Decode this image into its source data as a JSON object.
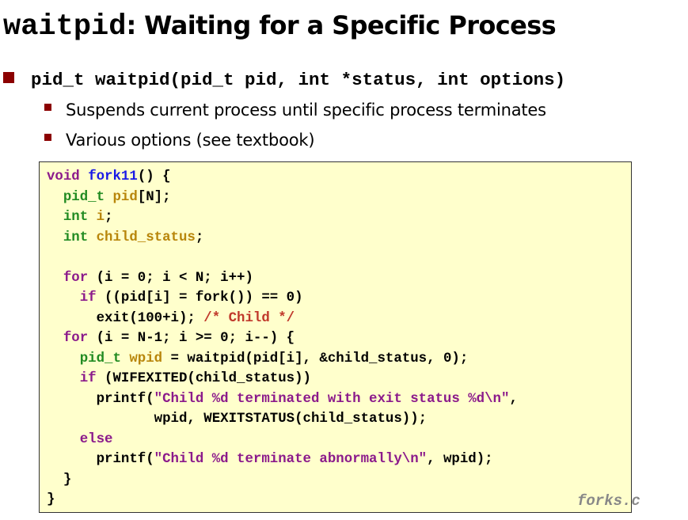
{
  "title": {
    "mono": "waitpid",
    "rest": ": Waiting for a Specific Process"
  },
  "bullet_main": "pid_t waitpid(pid_t pid, int *status, int options)",
  "sub_bullets": [
    "Suspends current process until specific process terminates",
    "Various options (see textbook)"
  ],
  "code": {
    "lines": [
      [
        {
          "t": "void ",
          "c": "kw"
        },
        {
          "t": "fork11",
          "c": "fn"
        },
        {
          "t": "() {",
          "c": ""
        }
      ],
      [
        {
          "t": "  ",
          "c": ""
        },
        {
          "t": "pid_t ",
          "c": "ty"
        },
        {
          "t": "pid",
          "c": "id"
        },
        {
          "t": "[N];",
          "c": ""
        }
      ],
      [
        {
          "t": "  ",
          "c": ""
        },
        {
          "t": "int ",
          "c": "ty"
        },
        {
          "t": "i",
          "c": "id"
        },
        {
          "t": ";",
          "c": ""
        }
      ],
      [
        {
          "t": "  ",
          "c": ""
        },
        {
          "t": "int ",
          "c": "ty"
        },
        {
          "t": "child_status",
          "c": "id"
        },
        {
          "t": ";",
          "c": ""
        }
      ],
      [
        {
          "t": "",
          "c": ""
        }
      ],
      [
        {
          "t": "  ",
          "c": ""
        },
        {
          "t": "for",
          "c": "kw"
        },
        {
          "t": " (i = 0; i < N; i++)",
          "c": ""
        }
      ],
      [
        {
          "t": "    ",
          "c": ""
        },
        {
          "t": "if",
          "c": "kw"
        },
        {
          "t": " ((pid[i] = fork()) == 0)",
          "c": ""
        }
      ],
      [
        {
          "t": "      exit(100+i); ",
          "c": ""
        },
        {
          "t": "/* Child */",
          "c": "cm"
        }
      ],
      [
        {
          "t": "  ",
          "c": ""
        },
        {
          "t": "for",
          "c": "kw"
        },
        {
          "t": " (i = N-1; i >= 0; i--) {",
          "c": ""
        }
      ],
      [
        {
          "t": "    ",
          "c": ""
        },
        {
          "t": "pid_t ",
          "c": "ty"
        },
        {
          "t": "wpid",
          "c": "id"
        },
        {
          "t": " = waitpid(pid[i], &child_status, 0);",
          "c": ""
        }
      ],
      [
        {
          "t": "    ",
          "c": ""
        },
        {
          "t": "if",
          "c": "kw"
        },
        {
          "t": " (WIFEXITED(child_status))",
          "c": ""
        }
      ],
      [
        {
          "t": "      printf(",
          "c": ""
        },
        {
          "t": "\"Child %d terminated with exit status %d\\n\"",
          "c": "str"
        },
        {
          "t": ",",
          "c": ""
        }
      ],
      [
        {
          "t": "             wpid, WEXITSTATUS(child_status));",
          "c": ""
        }
      ],
      [
        {
          "t": "    ",
          "c": ""
        },
        {
          "t": "else",
          "c": "kw"
        }
      ],
      [
        {
          "t": "      printf(",
          "c": ""
        },
        {
          "t": "\"Child %d terminate abnormally\\n\"",
          "c": "str"
        },
        {
          "t": ", wpid);",
          "c": ""
        }
      ],
      [
        {
          "t": "  }",
          "c": ""
        }
      ],
      [
        {
          "t": "}",
          "c": ""
        }
      ]
    ]
  },
  "filename": "forks.c",
  "colors": {
    "bullet": "#8b0000",
    "code_background": "#ffffcc",
    "keyword": "#8b1a8b",
    "type": "#228b22",
    "function": "#1a1ae6",
    "identifier": "#b8860b",
    "string": "#8b1a8b",
    "comment": "#c0392b"
  }
}
